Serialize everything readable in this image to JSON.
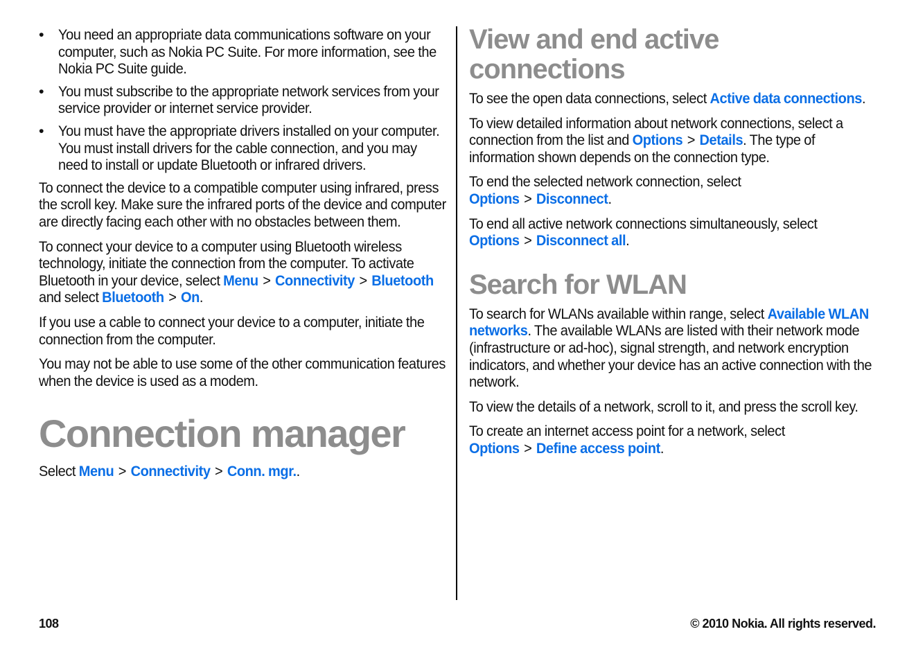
{
  "left_column": {
    "bullets": [
      "You need an appropriate data communications software on your computer, such as Nokia PC Suite. For more information, see the Nokia PC Suite guide.",
      "You must subscribe to the appropriate network services from your service provider or internet service provider.",
      "You must have the appropriate drivers installed on your computer. You must install drivers for the cable connection, and you may need to install or update Bluetooth or infrared drivers."
    ],
    "para_infrared": "To connect the device to a compatible computer using infrared, press the scroll key. Make sure the infrared ports of the device and computer are directly facing each other with no obstacles between them.",
    "para_bluetooth": {
      "text": "To connect your device to a computer using Bluetooth wireless technology, initiate the connection from the computer. To activate Bluetooth in your device, select ",
      "link1": "Menu",
      "link2": "Connectivity",
      "link3": "Bluetooth",
      "middle": " and select ",
      "link4": "Bluetooth",
      "link5": "On",
      "end": "."
    },
    "para_cable": "If you use a cable to connect your device to a computer, initiate the connection from the computer.",
    "para_modem": "You may not be able to use some of the other communication features when the device is used as a modem.",
    "heading": "Connection manager",
    "select_line": {
      "text": "Select ",
      "link1": "Menu",
      "link2": "Connectivity",
      "link3": "Conn. mgr.",
      "end": "."
    }
  },
  "right_column": {
    "heading1": "View and end active connections",
    "p1": {
      "text": "To see the open data connections, select ",
      "link1": "Active data connections",
      "end": "."
    },
    "p2": {
      "text": "To view detailed information about network connections, select a connection from the list and ",
      "link1": "Options",
      "link2": "Details",
      "end": ". The type of information shown depends on the connection type."
    },
    "p3": {
      "text": "To end the selected network connection, select ",
      "link1": "Options",
      "link2": "Disconnect",
      "end": "."
    },
    "p4": {
      "text": "To end all active network connections simultaneously, select ",
      "link1": "Options",
      "link2": "Disconnect all",
      "end": "."
    },
    "heading2": "Search for WLAN",
    "p5": {
      "text": "To search for WLANs available within range, select ",
      "link1": "Available WLAN networks",
      "end": ". The available WLANs are listed with their network mode (infrastructure or ad-hoc), signal strength, and network encryption indicators, and whether your device has an active connection with the network."
    },
    "p6": "To view the details of a network, scroll to it, and press the scroll key.",
    "p7": {
      "text": "To create an internet access point for a network, select ",
      "link1": "Options",
      "link2": "Define access point",
      "end": "."
    }
  },
  "separator": ">",
  "bullet_glyph": "•",
  "footer": {
    "page_number": "108",
    "copyright": "© 2010 Nokia. All rights reserved."
  },
  "colors": {
    "link": "#0a6ee6",
    "heading": "#8d8d8d",
    "text": "#111111"
  }
}
